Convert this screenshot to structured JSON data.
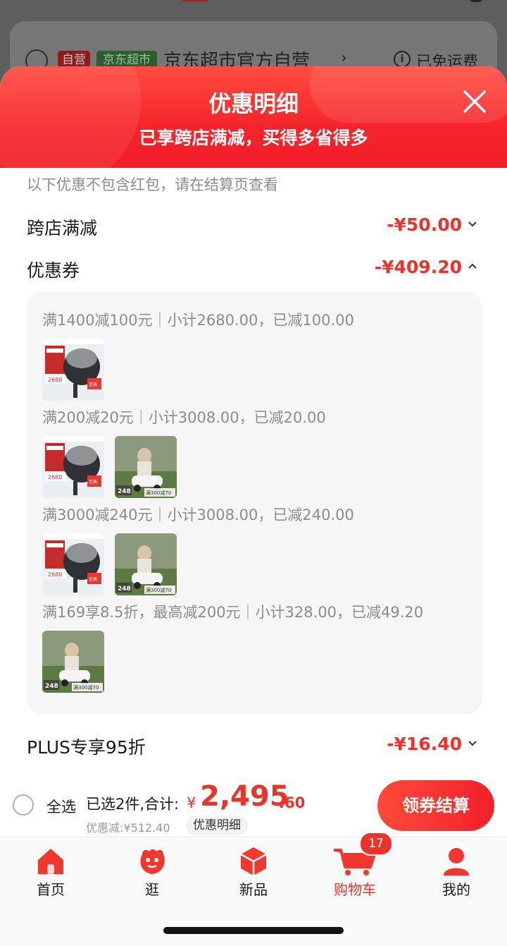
{
  "background": {
    "self_tag": "自营",
    "supermarket_tag": "京东超市",
    "shop_name": "京东超市官方自营",
    "shop_arrow": "›",
    "info_icon": "info-icon",
    "shipping": "已免运费"
  },
  "sheet": {
    "title": "优惠明细",
    "subtitle": "已享跨店满减，买得多省得多",
    "close_icon": "close-icon",
    "note": "以下优惠不包含红包，请在结算页查看",
    "rows": [
      {
        "label": "跨店满减",
        "amount": "-¥50.00",
        "caret": "⌄"
      },
      {
        "label": "优惠券",
        "amount": "-¥409.20",
        "caret": "⌃"
      },
      {
        "label": "PLUS专享95折",
        "amount": "-¥16.40",
        "caret": "⌄"
      }
    ],
    "coupons": [
      {
        "text": "满1400减100元｜小计2680.00，已减100.00",
        "products": [
          "seat"
        ]
      },
      {
        "text": "满200减20元｜小计3008.00，已减20.00",
        "products": [
          "seat",
          "car"
        ]
      },
      {
        "text": "满3000减240元｜小计3008.00，已减240.00",
        "products": [
          "seat",
          "car"
        ]
      },
      {
        "text": "满169享8.5折，最高减200元｜小计328.00，已减49.20",
        "products": [
          "car"
        ]
      }
    ],
    "thumb_text": {
      "seat_price": "2680",
      "seat_badge": "至高",
      "car_price": "248",
      "car_promo": "满300减70"
    }
  },
  "bottom_bar": {
    "select_all": "全选",
    "selected": "已选2件,合计:",
    "currency": "¥",
    "total_int": "2,495",
    "total_dec": ".60",
    "discount": "优惠减:¥512.40",
    "detail_chip": "优惠明细",
    "checkout": "领券结算"
  },
  "tab_bar": {
    "tabs": [
      {
        "label": "首页",
        "icon": "home-icon",
        "active": false
      },
      {
        "label": "逛",
        "icon": "browse-icon",
        "active": false
      },
      {
        "label": "新品",
        "icon": "new-items-box-icon",
        "active": false
      },
      {
        "label": "购物车",
        "icon": "cart-icon",
        "active": true
      },
      {
        "label": "我的",
        "icon": "user-icon",
        "active": false
      }
    ],
    "cart_badge": "17"
  },
  "colors": {
    "accent_red": "#e8342c",
    "header_red": "#f6242a",
    "muted_text": "#8c8c8c"
  }
}
